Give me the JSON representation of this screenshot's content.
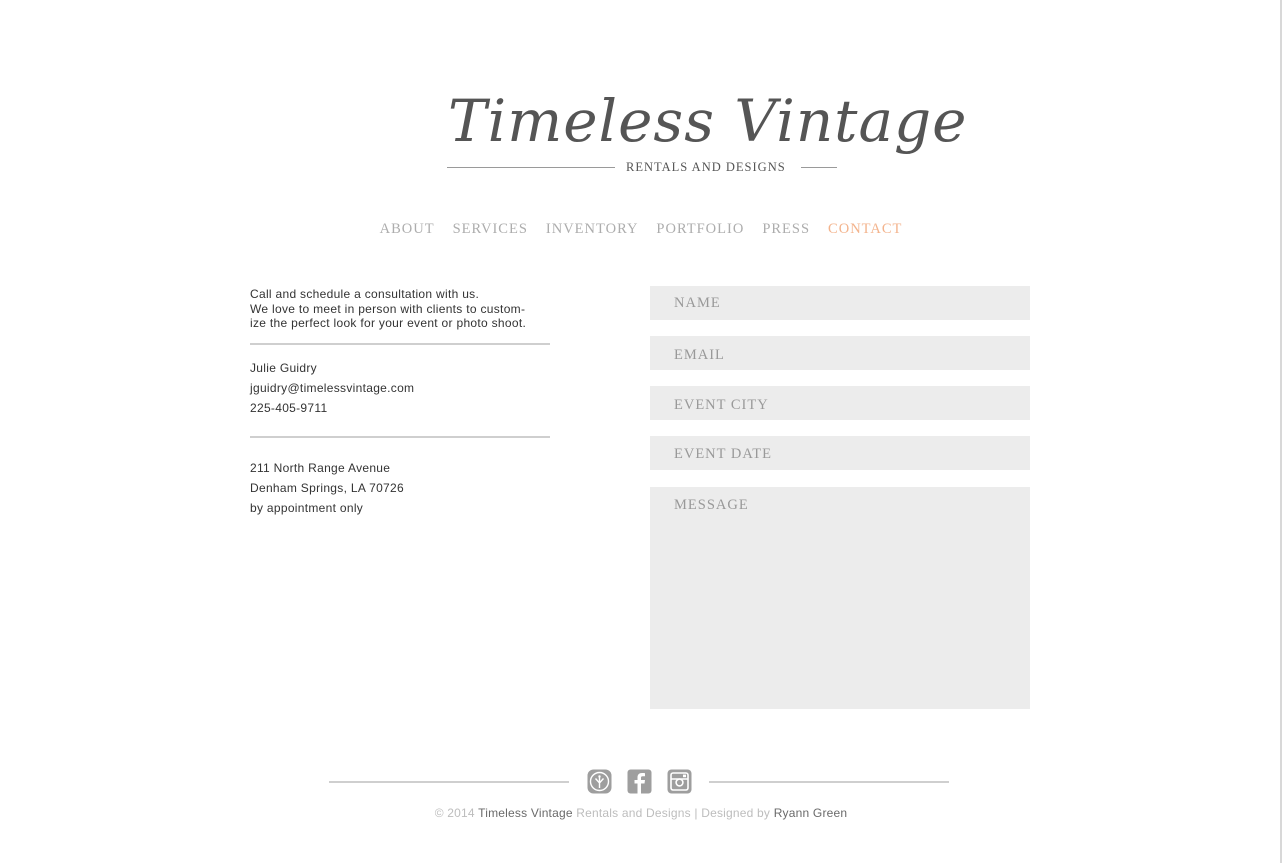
{
  "brand": {
    "logo_script": "Timeless Vintage",
    "logo_subtitle": "RENTALS AND DESIGNS"
  },
  "nav": {
    "items": [
      {
        "label": "ABOUT"
      },
      {
        "label": "SERVICES"
      },
      {
        "label": "INVENTORY"
      },
      {
        "label": "PORTFOLIO"
      },
      {
        "label": "PRESS"
      },
      {
        "label": "CONTACT"
      }
    ],
    "active": "CONTACT",
    "active_color": "#f3b38c"
  },
  "info": {
    "intro_lines": [
      "Call and schedule a consultation with us.",
      "We love to meet in person with clients to custom-",
      "ize the perfect look for your event or photo shoot."
    ],
    "contact_name": "Julie Guidry",
    "contact_email": "jguidry@timelessvintage.com",
    "contact_phone": "225-405-9711",
    "address_line1": "211 North Range Avenue",
    "address_line2": "Denham Springs, LA 70726",
    "address_note": "by appointment only"
  },
  "form": {
    "name_placeholder": "NAME",
    "email_placeholder": "EMAIL",
    "city_placeholder": "EVENT CITY",
    "date_placeholder": "EVENT DATE",
    "message_placeholder": "MESSAGE"
  },
  "social": [
    {
      "icon": "weddingwire-icon"
    },
    {
      "icon": "facebook-icon"
    },
    {
      "icon": "instagram-icon"
    }
  ],
  "footer": {
    "copyright": "© 2014",
    "brand": "Timeless Vintage",
    "brand_suffix": "Rentals and Designs",
    "separator": "|",
    "designed_by_label": "Designed by",
    "designer": "Ryann Green"
  }
}
